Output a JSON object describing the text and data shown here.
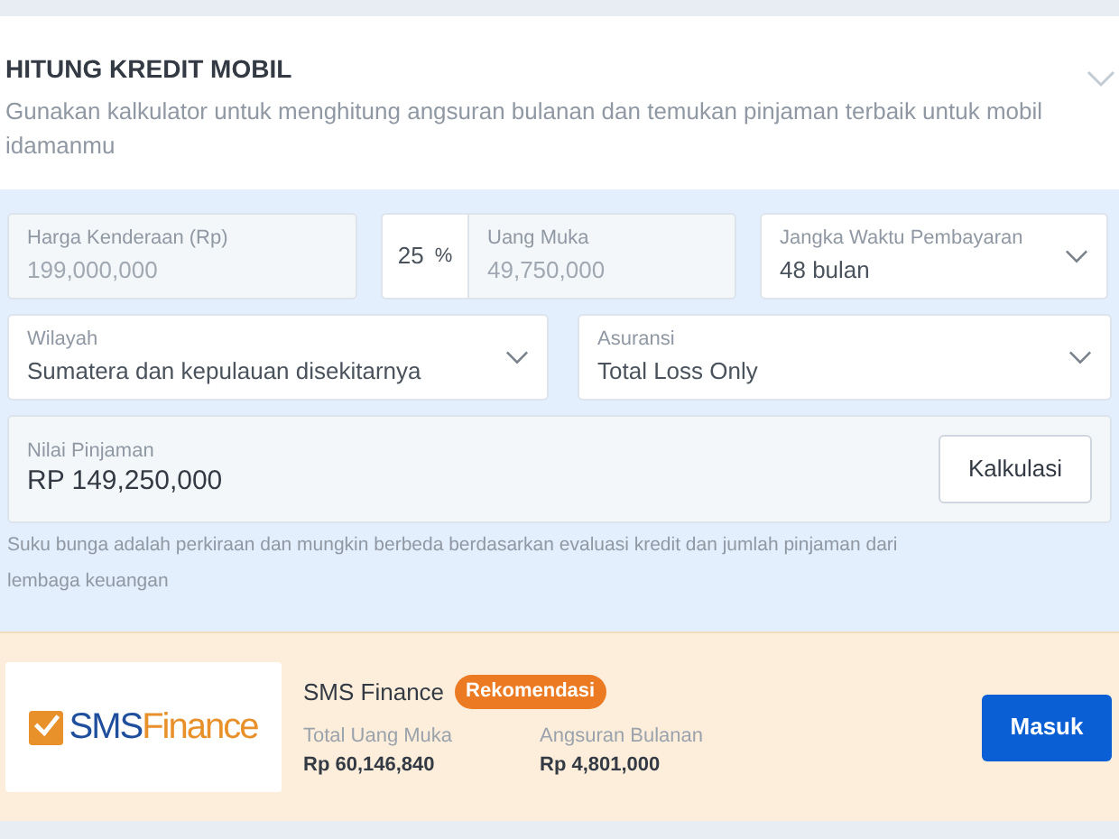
{
  "header": {
    "title": "HITUNG KREDIT MOBIL",
    "description": "Gunakan kalkulator untuk menghitung angsuran bulanan dan temukan pinjaman terbaik untuk mobil idamanmu",
    "expanded": false
  },
  "row_1": [
    {
      "kind": "input",
      "label": "Harga Kenderaan (Rp)",
      "value": "199,000,000",
      "disabled": true
    },
    {
      "kind": "percent",
      "percent": "25",
      "unit": "%",
      "label": "Uang Muka",
      "value": "49,750,000",
      "disabled": true
    },
    {
      "kind": "select",
      "label": "Jangka Waktu Pembayaran",
      "value": "48 bulan",
      "disabled": false
    }
  ],
  "row_2": [
    {
      "kind": "select",
      "label": "Wilayah",
      "value": "Sumatera dan kepulauan disekitarnya",
      "disabled": false
    },
    {
      "kind": "select",
      "label": "Asuransi",
      "value": "Total Loss Only",
      "disabled": false
    }
  ],
  "loan": {
    "label": "Nilai Pinjaman",
    "value": "RP 149,250,000",
    "button": "Kalkulasi"
  },
  "note": "Suku bunga adalah perkiraan dan mungkin berbeda berdasarkan evaluasi kredit dan jumlah pinjaman dari lembaga keuangan",
  "offers": [
    {
      "logo": {
        "part_1": "SMS",
        "part_2": "Finance"
      },
      "name": "SMS Finance",
      "badge": "Rekomendasi",
      "stats": [
        {
          "label": "Total Uang Muka",
          "value": "Rp 60,146,840"
        },
        {
          "label": "Angsuran Bulanan",
          "value": "Rp 4,801,000"
        }
      ],
      "button": "Masuk"
    }
  ]
}
